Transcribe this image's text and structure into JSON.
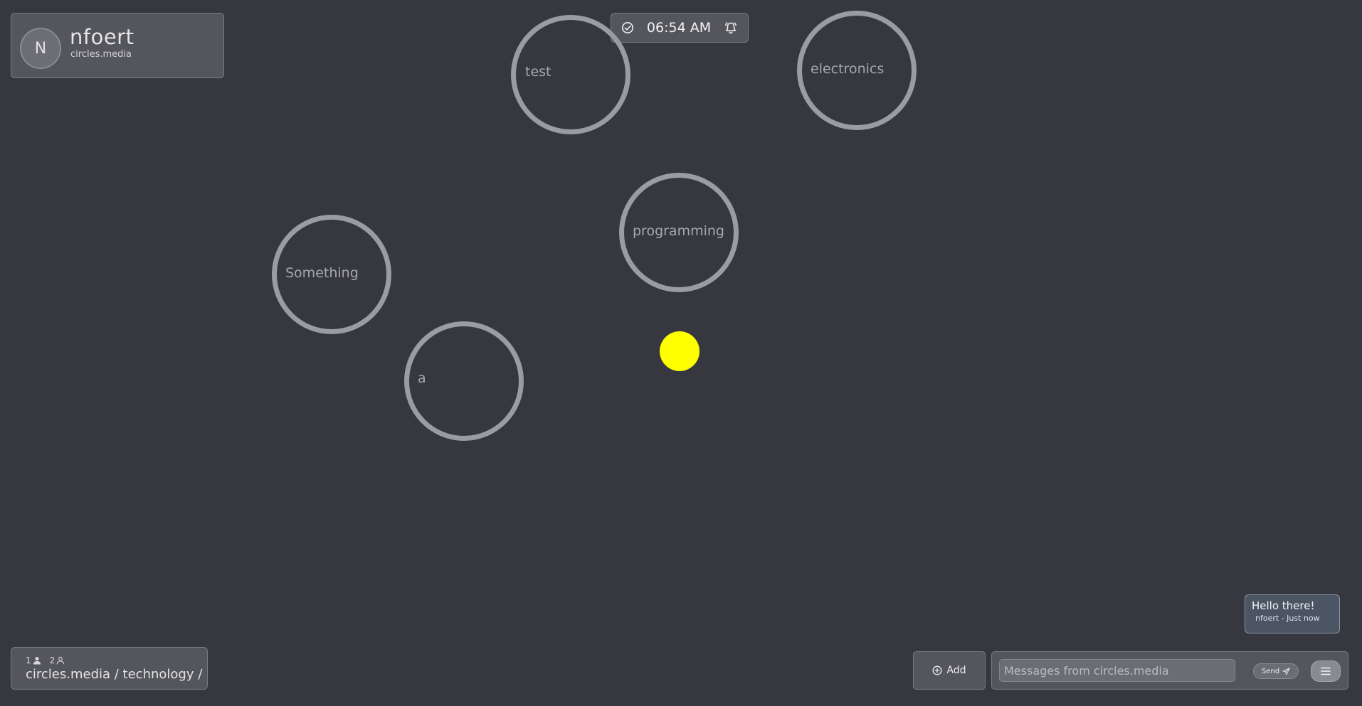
{
  "user": {
    "avatar_initial": "N",
    "name": "nfoert",
    "domain": "circles.media"
  },
  "clock": {
    "time": "06:54 AM",
    "left_icon": "check-circle-icon",
    "right_icon": "alarm-icon"
  },
  "circles": [
    {
      "label": "test"
    },
    {
      "label": "electronics"
    },
    {
      "label": "programming"
    },
    {
      "label": "Something"
    },
    {
      "label": "a"
    }
  ],
  "user_dot_color": "#ffff00",
  "location": {
    "count_a": "1",
    "count_b": "2",
    "breadcrumb": "circles.media / technology /"
  },
  "toast": {
    "title": "Hello there!",
    "meta": "nfoert - Just now"
  },
  "composer": {
    "add_label": "Add",
    "message_placeholder": "Messages from circles.media",
    "message_value": "",
    "send_label": "Send"
  }
}
